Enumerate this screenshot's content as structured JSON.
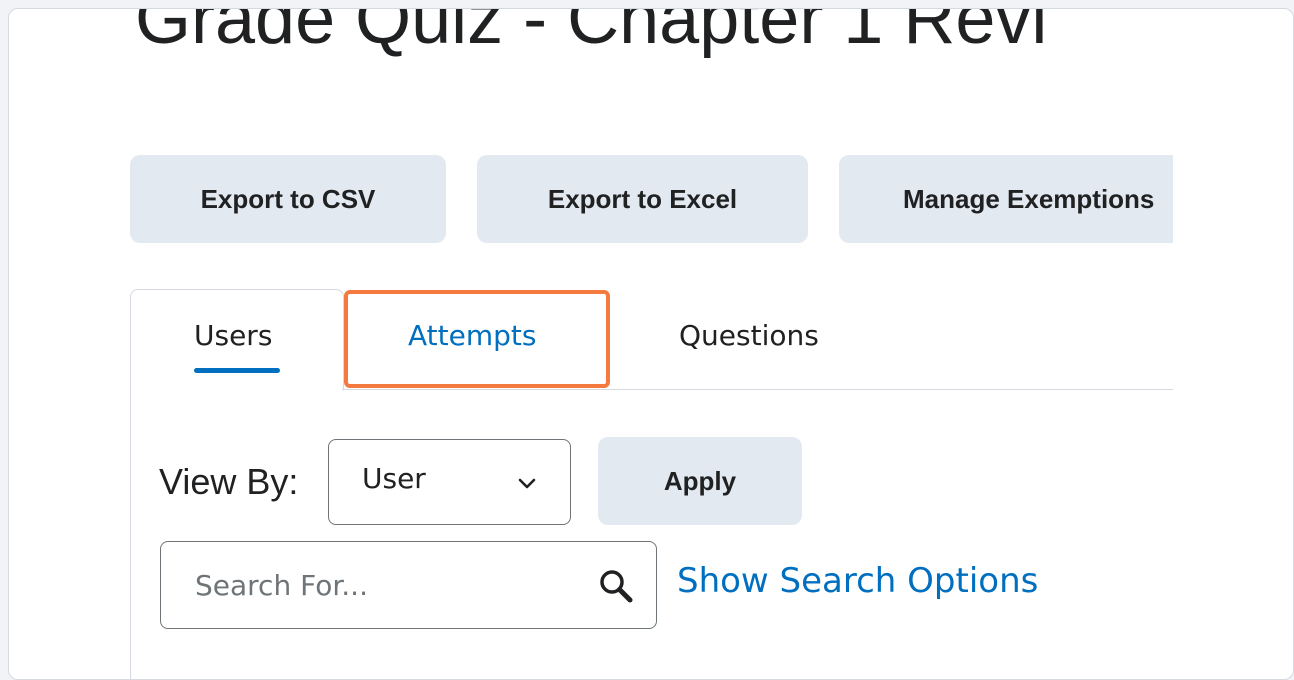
{
  "page": {
    "title": "Grade Quiz - Chapter 1 Revi"
  },
  "toolbar": {
    "export_csv_label": "Export to CSV",
    "export_excel_label": "Export to Excel",
    "manage_exemptions_label": "Manage Exemptions"
  },
  "tabs": [
    {
      "label": "Users",
      "active": true
    },
    {
      "label": "Attempts",
      "highlighted": true
    },
    {
      "label": "Questions"
    }
  ],
  "filters": {
    "view_by_label": "View By:",
    "view_by_value": "User",
    "apply_label": "Apply"
  },
  "search": {
    "placeholder": "Search For...",
    "options_link": "Show Search Options"
  },
  "colors": {
    "accent": "#006fbf",
    "highlight": "#f47a3f",
    "button_bg": "#e3e9f1"
  },
  "icons": {
    "dropdown": "chevron-down-icon",
    "search": "search-icon"
  }
}
